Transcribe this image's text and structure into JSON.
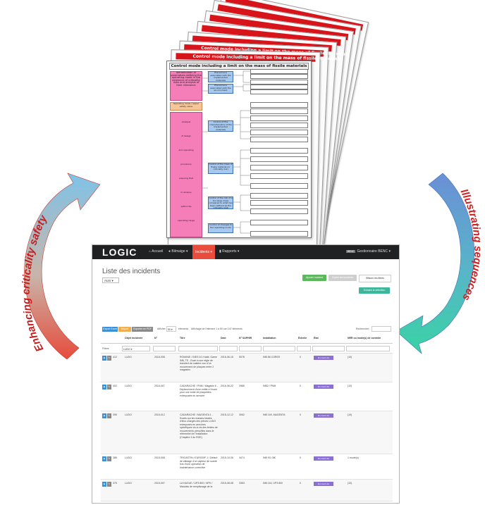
{
  "arrows": {
    "left": {
      "label": "Enhancing criticality safety"
    },
    "right": {
      "label": "Illustrating sequences"
    }
  },
  "colors": {
    "pink": "#f57eb9",
    "blue_box": "#a7c9ef",
    "orange_box": "#f6c69b",
    "sheet_header_red": "#d8141b",
    "left_arrow_start": "#e74c3c",
    "left_arrow_end": "#7ec3e8",
    "right_arrow_start": "#6b8fd6",
    "right_arrow_end": "#39d3a4",
    "app_topbar": "#1f2122",
    "app_nav_active": "#e74c3c"
  },
  "sheets": {
    "back_headers": [
      "Control mode including a limit on the mass of fissile materials",
      "Control mode including a limit on the mass of fissile materials",
      "Control mode including a limit on the mass of fissile materials",
      "Control mode including a limit on the mass of fissile materials",
      "Control mode including a limit on the mass of fissile materials",
      "Control mode including a limit on the mass of fissile materials",
      "Control mode including a limit on the mass of fissile materials"
    ],
    "front_title": "Control mode including a limit on the mass of fissile materials",
    "pink_boxes": [
      "Identification of parameters defining the operating mode in the existence of criticality risks and analysis of their relevance",
      "Analysis",
      "of design",
      "and operating",
      "provisions",
      "ensuring that",
      "it remains",
      "within the",
      "operating range"
    ],
    "orange_box": "Operating mode / Upper safety value",
    "blue_boxes": [
      "Phenomena associated with the implemented materials",
      "Phenomena associated with the environment",
      "Control of the characteristics of the implemented materials",
      "Control of the mass of fissile material (or criticality risk)",
      "Control of the risk of a too large mass compared to what has been defined as the criticality limit",
      "Control of changes to the operating mode"
    ]
  },
  "app": {
    "logo": "LOGIC",
    "nav": [
      "Accueil",
      "Bilmaige",
      "Incidents",
      "Rapports"
    ],
    "user": "Gestionnaire BENC",
    "user_badge": "BENC",
    "page_title": "Liste des incidents",
    "status_filter": "AUS",
    "buttons": {
      "add": "Ajouter incident",
      "duplicate": "Copier les incidents",
      "clear_filters": "Effacer les filtres",
      "export": "Extraire la sélection"
    },
    "export_tags": [
      "Export Excel",
      "Export PDF",
      "Exporter en PDF"
    ],
    "display_label": "Afficher",
    "page_size": "50",
    "entries_text": "éléments",
    "range_text": "Affichage de l'élément 1 à 50 sur 147 éléments",
    "search_label": "Rechercher :",
    "columns": [
      "",
      "Objet incidenté",
      "N°",
      "Titre",
      "Date",
      "N° SAPHIR",
      "Installation",
      "Échelle",
      "État",
      "NRR ou mode(s) de contrôle"
    ],
    "filter_label": "Filtres",
    "filter_value": "LUDO",
    "rows": [
      {
        "id": "412",
        "object": "LUDO",
        "number": "2016-008",
        "title": "ROMANE / INES 0/1 Habit, Game INB, TE - Ecart à une règle de transfert de matière non d'un mouvement de plaques entre 2 magasins",
        "date": "2016-06-15",
        "saphir": "5078",
        "installation": "INB 86 CORES",
        "scale": "0",
        "state": "En cours de traitement",
        "nrr": "(10)"
      },
      {
        "id": "402",
        "object": "LUDO",
        "number": "2016-007",
        "title": "CADARACHE / PNM / Magasin 6 - Déplacement d'une entité à l'écart pour une boîte de plaquettes entreposée en armoire",
        "date": "2016-06-22",
        "saphir": "3985",
        "installation": "INB2 / PNM",
        "scale": "0",
        "state": "En cours de traitement",
        "nrr": "(10)"
      },
      {
        "id": "395",
        "object": "LUDO",
        "number": "2015-012",
        "title": "CADARACHE / MAGENTA 1 - Ecarts sur les masses totales d'élus chargés des pièces LUDO entreposés en armoires spécifiques vis-à-vis des limites de mouvements prescrites dans le référentiel de l'installation (Chapitre 4 du RGE)",
        "date": "2015-12-12",
        "saphir": "3062",
        "installation": "INB 169, MAGENTA",
        "scale": "0",
        "state": "En cours de traitement",
        "nrr": "(10)"
      },
      {
        "id": "385",
        "object": "LUDO",
        "number": "2015-008",
        "title": "TRICASTIN / EURODIF 1 / Défaut de câblage d'un capteur de sureté lors d'une opération de maintenance corrective",
        "date": "2015-10-06",
        "saphir": "3474",
        "installation": "INB 93, 080",
        "scale": "0",
        "state": "En cours de traitement",
        "nrr": "1 mode(s)"
      },
      {
        "id": "375",
        "object": "LUDO",
        "number": "2015-007",
        "title": "LA HAGUE / UP3 800 / NPH / Mauvais de remplissage de la",
        "date": "2015-08-08",
        "saphir": "3353",
        "installation": "INB 116, UP3 800",
        "scale": "0",
        "state": "En cours de traitement",
        "nrr": "(10)"
      }
    ]
  }
}
